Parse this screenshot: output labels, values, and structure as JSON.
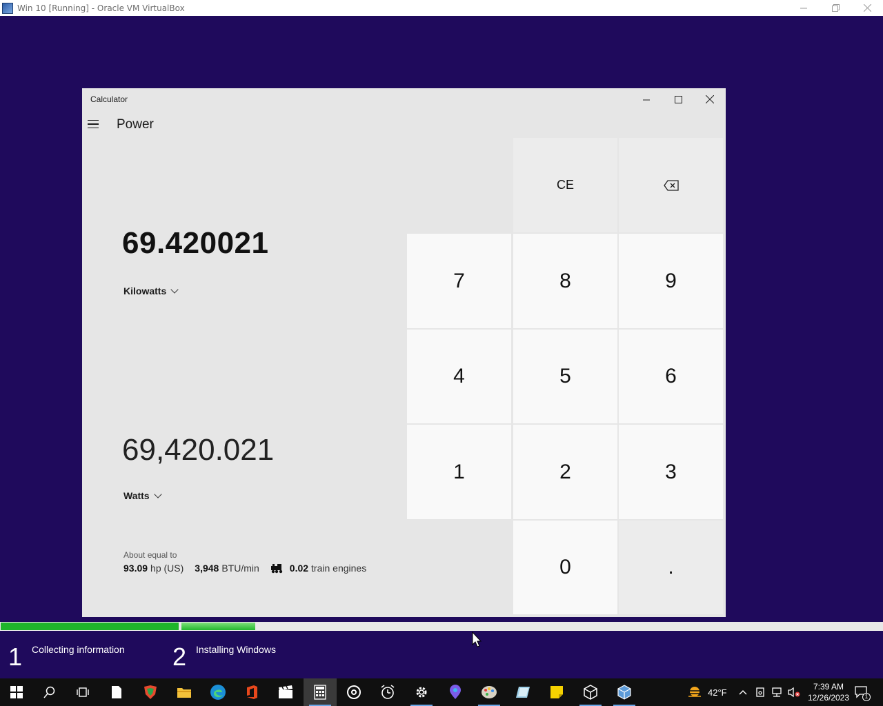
{
  "host": {
    "title": "Win 10 [Running] - Oracle VM VirtualBox"
  },
  "calculator": {
    "window_title": "Calculator",
    "mode": "Power",
    "from_value": "69.420021",
    "from_unit": "Kilowatts",
    "to_value": "69,420.021",
    "to_unit": "Watts",
    "about_label": "About equal to",
    "equivalents": [
      {
        "value": "93.09",
        "unit": "hp (US)"
      },
      {
        "value": "3,948",
        "unit": "BTU/min"
      },
      {
        "value": "0.02",
        "unit": "train engines",
        "icon": "train-icon"
      }
    ],
    "keys": {
      "ce": "CE",
      "seven": "7",
      "eight": "8",
      "nine": "9",
      "four": "4",
      "five": "5",
      "six": "6",
      "one": "1",
      "two": "2",
      "three": "3",
      "zero": "0",
      "decimal": "."
    }
  },
  "installer": {
    "steps": [
      {
        "number": "1",
        "label": "Collecting information"
      },
      {
        "number": "2",
        "label": "Installing Windows"
      }
    ],
    "progress_color": "#1fb52b"
  },
  "taskbar": {
    "weather": "42°F",
    "time": "7:39 AM",
    "date": "12/26/2023",
    "notification_count": "1"
  },
  "colors": {
    "desktop_bg": "#1f0a5c",
    "calc_bg": "#e6e6e6",
    "key_bg": "#f9f9f9"
  }
}
